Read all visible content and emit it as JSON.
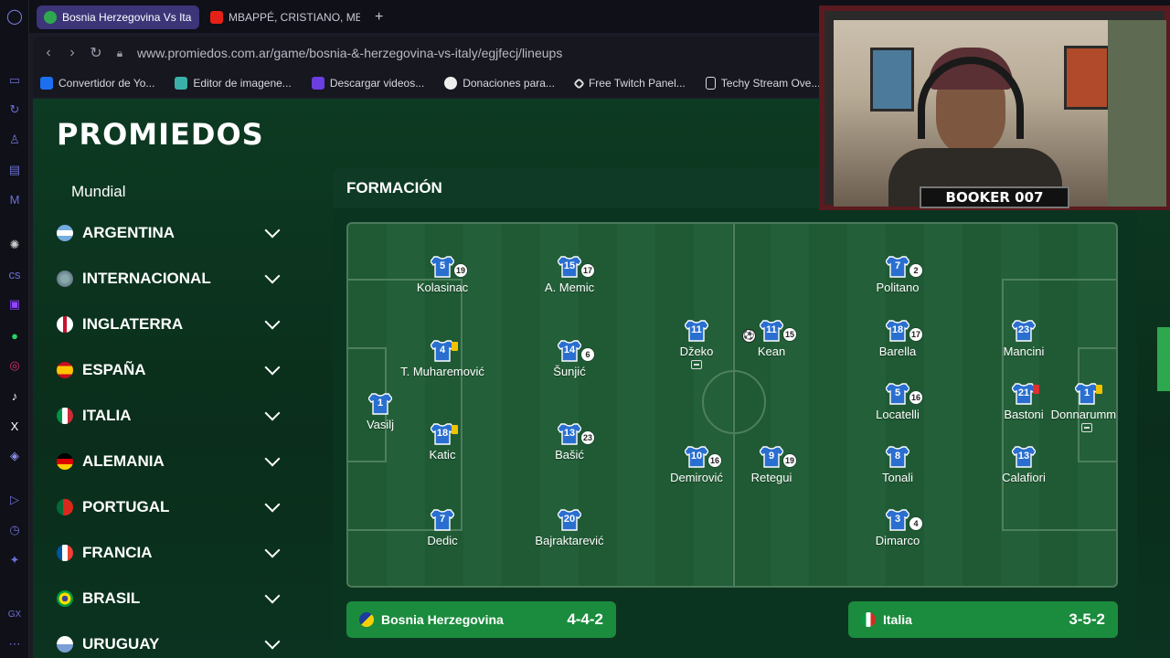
{
  "browser": {
    "tabs": [
      {
        "label": "Bosnia Herzegovina Vs Ita",
        "active": true
      },
      {
        "label": "MBAPPÉ, CRISTIANO, MES",
        "active": false
      }
    ],
    "new_tab": "+",
    "url": "www.promiedos.com.ar/game/bosnia-&-herzegovina-vs-italy/egjfecj/lineups",
    "bookmarks": [
      "Convertidor de Yo...",
      "Editor de imagene...",
      "Descargar videos...",
      "Donaciones para...",
      "Free Twitch Panel...",
      "Techy Stream Ove..."
    ]
  },
  "site": {
    "logo": "PROMIEDOS",
    "sidebar_title": "Mundial",
    "leagues": [
      "ARGENTINA",
      "INTERNACIONAL",
      "INGLATERRA",
      "ESPAÑA",
      "ITALIA",
      "ALEMANIA",
      "PORTUGAL",
      "FRANCIA",
      "BRASIL",
      "URUGUAY"
    ]
  },
  "formation": {
    "title": "FORMACIÓN",
    "home": {
      "name": "Bosnia Herzegovina",
      "formation": "4-4-2",
      "players": [
        {
          "num": "1",
          "name": "Vasilj"
        },
        {
          "num": "5",
          "name": "Kolasinac",
          "rating": "19"
        },
        {
          "num": "4",
          "name": "T. Muharemović",
          "card": "yellow"
        },
        {
          "num": "18",
          "name": "Katic",
          "card": "yellow"
        },
        {
          "num": "7",
          "name": "Dedic"
        },
        {
          "num": "15",
          "name": "A. Memic",
          "rating": "17"
        },
        {
          "num": "14",
          "name": "Šunjić",
          "rating": "6"
        },
        {
          "num": "13",
          "name": "Bašić",
          "rating": "23"
        },
        {
          "num": "20",
          "name": "Bajraktarević"
        },
        {
          "num": "11",
          "name": "Džeko",
          "sub": true
        },
        {
          "num": "10",
          "name": "Demirović",
          "rating": "16"
        }
      ]
    },
    "away": {
      "name": "Italia",
      "formation": "3-5-2",
      "players": [
        {
          "num": "11",
          "name": "Kean",
          "rating": "15",
          "goal": true
        },
        {
          "num": "9",
          "name": "Retegui",
          "rating": "19"
        },
        {
          "num": "7",
          "name": "Politano",
          "rating": "2"
        },
        {
          "num": "18",
          "name": "Barella",
          "rating": "17"
        },
        {
          "num": "5",
          "name": "Locatelli",
          "rating": "16"
        },
        {
          "num": "8",
          "name": "Tonali"
        },
        {
          "num": "3",
          "name": "Dimarco",
          "rating": "4"
        },
        {
          "num": "23",
          "name": "Mancini"
        },
        {
          "num": "21",
          "name": "Bastoni",
          "card": "red"
        },
        {
          "num": "13",
          "name": "Calafiori"
        },
        {
          "num": "1",
          "name": "Donnarumma",
          "card": "yellow",
          "sub": true
        }
      ]
    }
  },
  "webcam": {
    "label": "BOOKER 007"
  },
  "colors": {
    "pitch": "#1f5a34",
    "team_bar": "#1b8b3e",
    "shirt": "#2a6fd0",
    "yellow_card": "#f2c200",
    "red_card": "#e03030"
  }
}
